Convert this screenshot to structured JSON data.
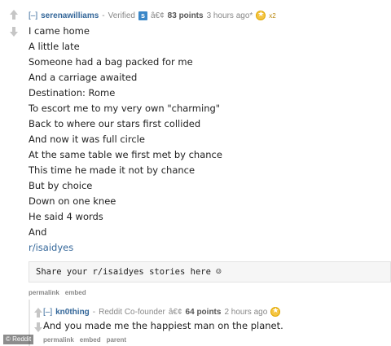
{
  "comment": {
    "toggle": "[–]",
    "author": "serenawilliams",
    "separator": "-",
    "flair_text": "Verified",
    "flair_badge": "s",
    "bullet": "â€¢",
    "points": "83 points",
    "time": "3 hours ago*",
    "gilded_count": "x2",
    "gold_icon": "reddit-gold-icon",
    "lines": [
      "I came home",
      "A little late",
      "Someone had a bag packed for me",
      "And a carriage awaited",
      "Destination: Rome",
      "To escort me to my very own \"charming\"",
      "Back to where our stars first collided",
      "And now it was full circle",
      "At the same table we first met by chance",
      "This time he made it not by chance",
      "But by choice",
      "Down on one knee",
      "He said 4 words",
      "And"
    ],
    "link": "r/isaidyes",
    "quote": "Share your r/isaidyes stories here ☺",
    "buttons": [
      "permalink",
      "embed"
    ]
  },
  "reply": {
    "toggle": "[–]",
    "author": "kn0thing",
    "separator": "-",
    "flair_text": "Reddit Co-founder",
    "bullet": "â€¢",
    "points": "64 points",
    "time": "2 hours ago",
    "gold_icon": "reddit-gold-icon",
    "text": "And you made me the happiest man on the planet.",
    "buttons": [
      "permalink",
      "embed",
      "parent"
    ]
  },
  "credit": "© Reddit",
  "colors": {
    "link": "#336699",
    "upvote": "#c6c6c6",
    "gold": "#f5c542",
    "flair": "#3a87c8"
  }
}
